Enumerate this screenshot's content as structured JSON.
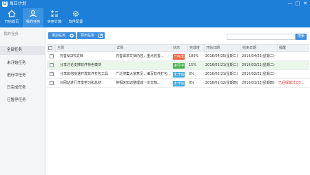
{
  "app": {
    "title": "每日计划",
    "logo": "日",
    "window_buttons": [
      "—",
      "□",
      "✕"
    ]
  },
  "toolbar": [
    {
      "label": "开始首页",
      "icon": "home-icon"
    },
    {
      "label": "我的任务",
      "icon": "tasks-icon"
    },
    {
      "label": "实用计算",
      "icon": "calculator-icon"
    },
    {
      "label": "软件配置",
      "icon": "gear-icon"
    }
  ],
  "sidebar": {
    "heading": "我的任务",
    "items": [
      "全部任务",
      "未开始任务",
      "进行中任务",
      "已完成任务",
      "已暂停任务"
    ]
  },
  "actions": {
    "add_task": "添加任务",
    "export_task": "导出任务",
    "search_button": "搜索",
    "search_placeholder": ""
  },
  "table": {
    "headers": [
      "",
      "主题",
      "详情",
      "状态",
      "完成度",
      "开始日期",
      "结束日期",
      "提醒"
    ],
    "rows": [
      {
        "subject": "完善NGPS文档",
        "details": "完善需求文档内容，重点完善...",
        "status": "已完成",
        "progress": "100%",
        "start": "2016/04/25(星期二)",
        "end": "2016/04/25(星期二)",
        "reminder": "",
        "status_color": "#f0603c"
      },
      {
        "subject": "分享讨论支撑软件特色模块",
        "details": "",
        "status": "进行中",
        "progress": "15%",
        "start": "2016/02/21(星期二)",
        "end": "2016/03/21(星期二)",
        "reminder": "",
        "status_color": "#4caf50"
      },
      {
        "subject": "分享如何快速开发软件打包工具",
        "details": "广泛搜集大家意见，编写软件打包...",
        "status": "未开始",
        "progress": "0%",
        "start": "2016/02/21(星期二)",
        "end": "2016/02/21(星期二)",
        "reminder": "",
        "status_color": "#3fa9e6"
      },
      {
        "subject": "对网站进行开发学习和总结",
        "details": "将相关知识整理成一份文档...",
        "status": "未开始",
        "progress": "0%",
        "start": "2016/01/12(星期四)",
        "end": "2016/01/12(星期四)",
        "reminder": "已经提醒过2次...",
        "status_color": "#3fa9e6"
      }
    ]
  }
}
